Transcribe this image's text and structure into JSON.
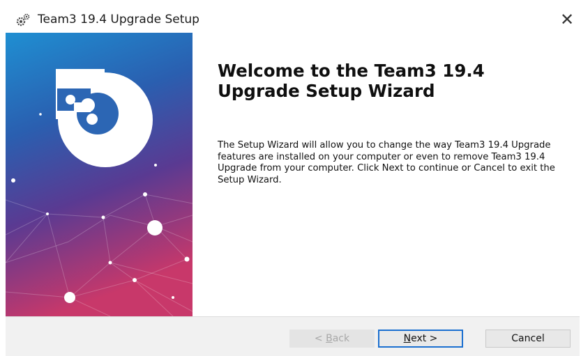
{
  "window": {
    "title": "Team3 19.4 Upgrade Setup",
    "close_symbol": "✕",
    "icon": "setup-gears-icon"
  },
  "banner": {
    "logo": "puzzle-logo",
    "gradient_top": "#1a8fd0",
    "gradient_bottom": "#c43a6e"
  },
  "content": {
    "heading": "Welcome to the Team3 19.4 Upgrade Setup Wizard",
    "description": "The Setup Wizard will allow you to change the way Team3 19.4 Upgrade features are installed on your computer or even to remove Team3 19.4 Upgrade from your computer.  Click Next to continue or Cancel to exit the Setup Wizard."
  },
  "footer": {
    "back": {
      "accel": "B",
      "rest": "ack",
      "prefix": "< ",
      "enabled": false
    },
    "next": {
      "accel": "N",
      "rest": "ext >"
    },
    "cancel_label": "Cancel"
  }
}
